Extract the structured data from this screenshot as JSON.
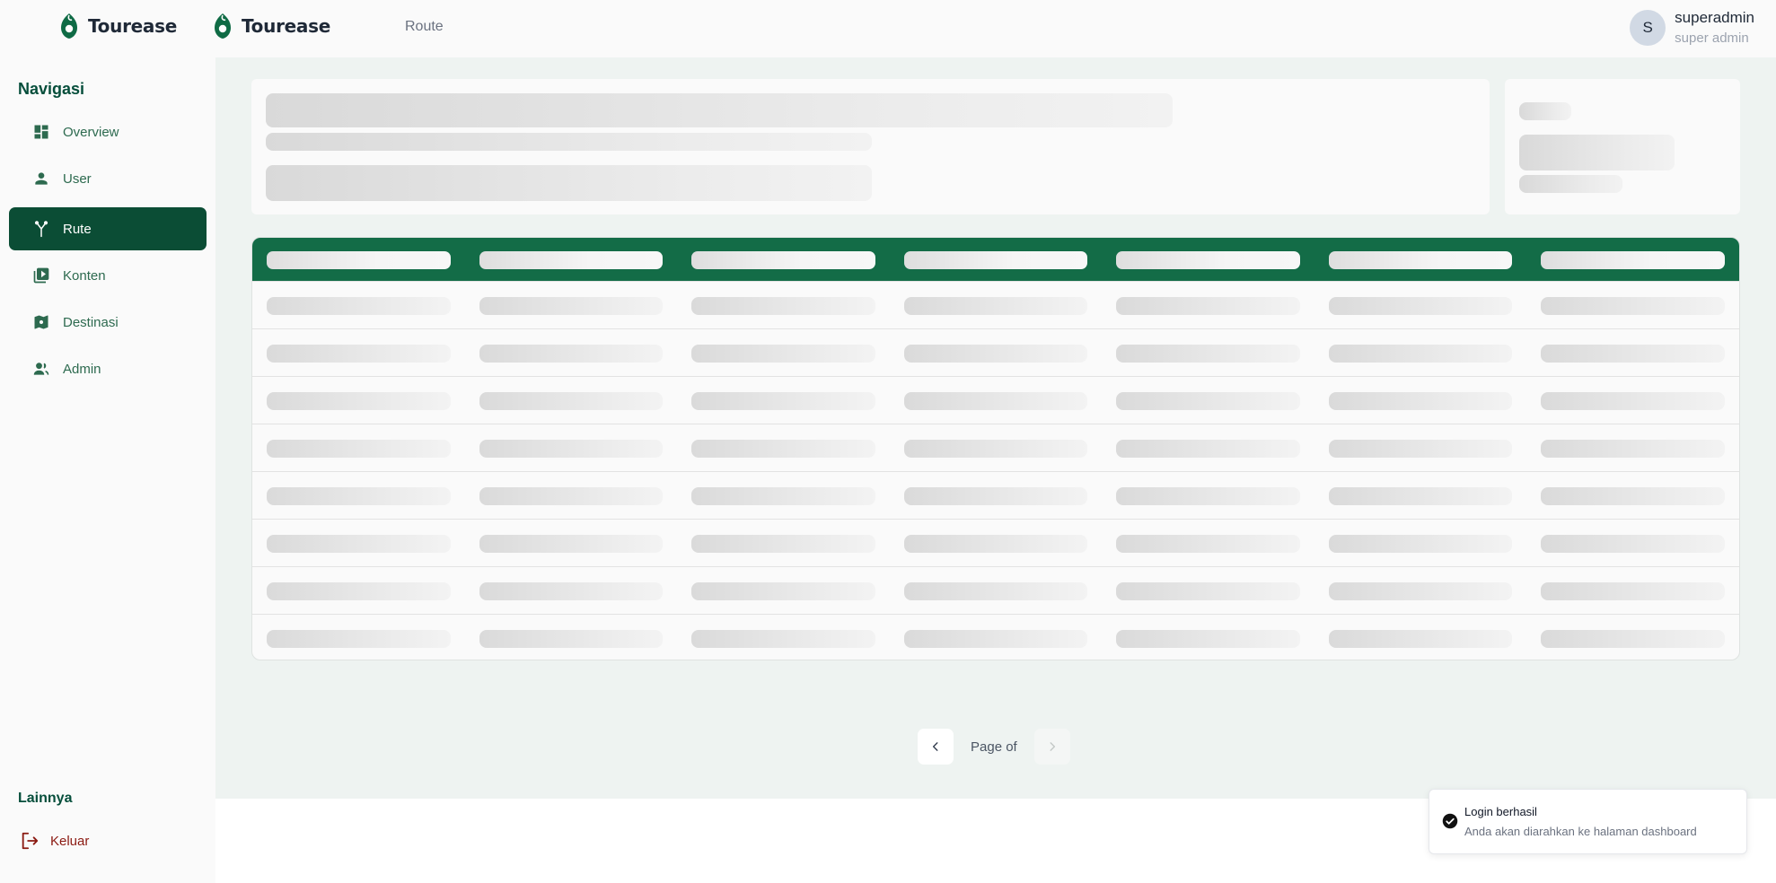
{
  "header": {
    "brand_name": "Tourease",
    "brand_name_2": "Tourease",
    "breadcrumb": "Route",
    "user": {
      "initial": "S",
      "name": "superadmin",
      "role": "super admin"
    }
  },
  "sidebar": {
    "nav_title": "Navigasi",
    "items": [
      {
        "label": "Overview",
        "icon": "dashboard-icon"
      },
      {
        "label": "User",
        "icon": "user-icon"
      },
      {
        "label": "Rute",
        "icon": "route-icon",
        "active": true
      },
      {
        "label": "Konten",
        "icon": "video-library-icon"
      },
      {
        "label": "Destinasi",
        "icon": "map-icon"
      },
      {
        "label": "Admin",
        "icon": "group-icon"
      }
    ],
    "other_title": "Lainnya",
    "logout_label": "Keluar"
  },
  "main": {
    "table": {
      "columns": 7,
      "rows": 8,
      "state": "loading"
    },
    "pagination": {
      "label": "Page of"
    }
  },
  "toast": {
    "title": "Login berhasil",
    "message": "Anda akan diarahkan ke halaman dashboard"
  },
  "colors": {
    "primary": "#0b4d35",
    "table_header": "#136c47",
    "nav_text": "#2d6a4f",
    "logout": "#8b1a12",
    "main_bg": "#eef3f1"
  }
}
